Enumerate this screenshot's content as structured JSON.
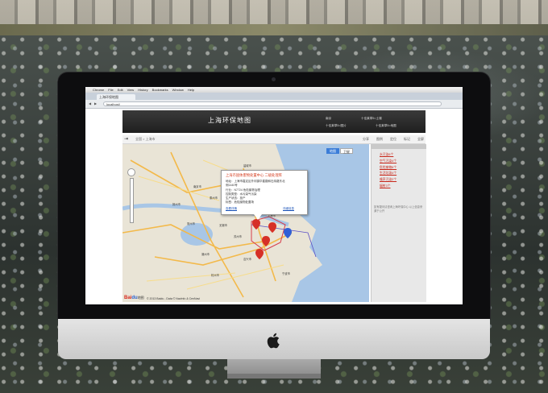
{
  "browser": {
    "menu_items": [
      "Chrome",
      "File",
      "Edit",
      "View",
      "History",
      "Bookmarks",
      "Window",
      "Help"
    ],
    "tab_title": "上海环保地图",
    "url": "localhost/"
  },
  "site": {
    "title": "上海环保地图",
    "header_info": [
      "南京",
      "十佳莱草5=土壤",
      "十佳莱草5=图片",
      "十佳莱草5=地图"
    ],
    "breadcrumb": "全国 > 上海市",
    "toolbar": [
      "分享",
      "图例",
      "定位",
      "标记",
      "全屏"
    ]
  },
  "map": {
    "type_buttons": {
      "active": "地图",
      "inactive": "卫星"
    },
    "popup": {
      "title": "上海市固体废物处置中心 二级处理库",
      "lines": [
        "地址：上海市嘉定区外冈镇华星路和石纬路东北",
        "侧1440号",
        "行业：N7724 危险废物治理",
        "控制类型：水污染气污染",
        "生产状态：投产",
        "标签：危险废物处置场"
      ],
      "link_left": "查看详情",
      "link_right": "详细信息"
    },
    "logo": {
      "bai": "Bai",
      "du": "du",
      "suffix": "地图"
    },
    "copyright": "© 2013 Baidu - Data © NavInfo & CenNavi",
    "cities": [
      "南京市",
      "盐城市",
      "泰州市",
      "扬州市",
      "无锡市",
      "苏州市",
      "常州市",
      "上海市",
      "嘉兴市",
      "湖州市",
      "杭州市",
      "宁波市"
    ],
    "markers": [
      {
        "label": "marker-red",
        "color": "#d63027"
      },
      {
        "label": "marker-blue",
        "color": "#2f5fd6"
      }
    ]
  },
  "panel": {
    "links": [
      "水污染6个",
      "空气污染4个",
      "危险废物8个",
      "生活垃圾4个",
      "噪声污染2个",
      "辐射3个"
    ],
    "note": "如有疑问请咨询上海环保中心 以上信息来源于公开"
  },
  "colors": {
    "header_bg": "#2b2b2b",
    "link_red": "#c8271a",
    "map_active": "#3b7dd8"
  }
}
